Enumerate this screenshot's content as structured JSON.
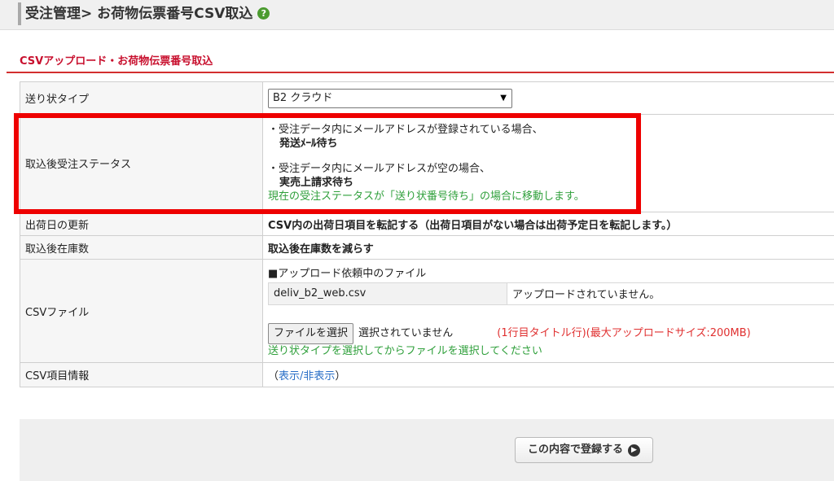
{
  "header": {
    "title": "受注管理> お荷物伝票番号CSV取込",
    "help_icon": "question-icon"
  },
  "section": {
    "title": "CSVアップロード・お荷物伝票番号取込"
  },
  "rows": {
    "invoice_type": {
      "label": "送り状タイプ",
      "selected": "B2 クラウド"
    },
    "status": {
      "label": "取込後受注ステータス",
      "case1": "・受注データ内にメールアドレスが登録されている場合、",
      "case1_value": "発送ﾒｰﾙ待ち",
      "case2": "・受注データ内にメールアドレスが空の場合、",
      "case2_value": "実売上請求待ち",
      "note": "現在の受注ステータスが「送り状番号待ち」の場合に移動します。"
    },
    "ship_date": {
      "label": "出荷日の更新",
      "value": "CSV内の出荷日項目を転記する（出荷日項目がない場合は出荷予定日を転記します。）"
    },
    "stock": {
      "label": "取込後在庫数",
      "value": "取込後在庫数を減らす"
    },
    "csv_file": {
      "label": "CSVファイル",
      "upload_heading": "■アップロード依頼中のファイル",
      "filename": "deliv_b2_web.csv",
      "upload_status": "アップロードされていません。",
      "choose_button": "ファイルを選択",
      "no_file": "選択されていません",
      "size_note": "(1行目タイトル行)(最大アップロードサイズ:200MB)",
      "hint": "送り状タイプを選択してからファイルを選択してください"
    },
    "csv_info": {
      "label": "CSV項目情報",
      "paren_open": "（",
      "toggle_link": "表示/非表示",
      "paren_close": "）"
    }
  },
  "footer": {
    "submit_label": "この内容で登録する",
    "submit_icon": "arrow-right-icon"
  },
  "colors": {
    "accent_red": "#d32f2f",
    "note_green": "#2e9f3a",
    "link_blue": "#2a6fc7",
    "highlight": "#ee0000"
  }
}
